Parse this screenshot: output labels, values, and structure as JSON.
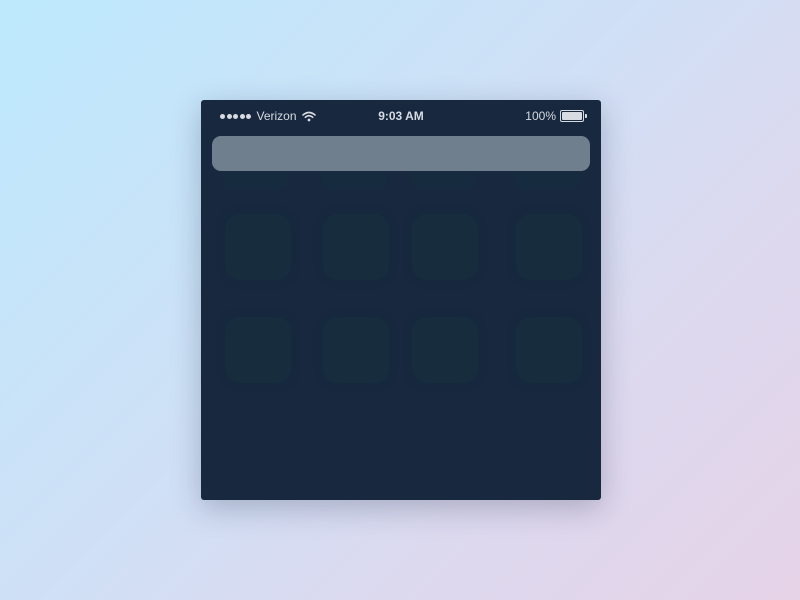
{
  "status_bar": {
    "carrier": "Verizon",
    "time": "9:03 AM",
    "battery_percent": "100%",
    "signal_bars": 5,
    "battery_level": 1.0,
    "icons": [
      "signal-dots-icon",
      "wifi-icon",
      "battery-icon"
    ]
  },
  "search_bar": {
    "placeholder": ""
  },
  "home_grid": {
    "rows": 2,
    "columns": 4,
    "slots": [
      "",
      "",
      "",
      "",
      "",
      "",
      "",
      ""
    ]
  },
  "colors": {
    "background_start": "#bde9fd",
    "background_end": "#e6d3e8",
    "screen": "#17283f",
    "search_bar": "#6f7f8e",
    "status_text": "#d7dbe2"
  }
}
